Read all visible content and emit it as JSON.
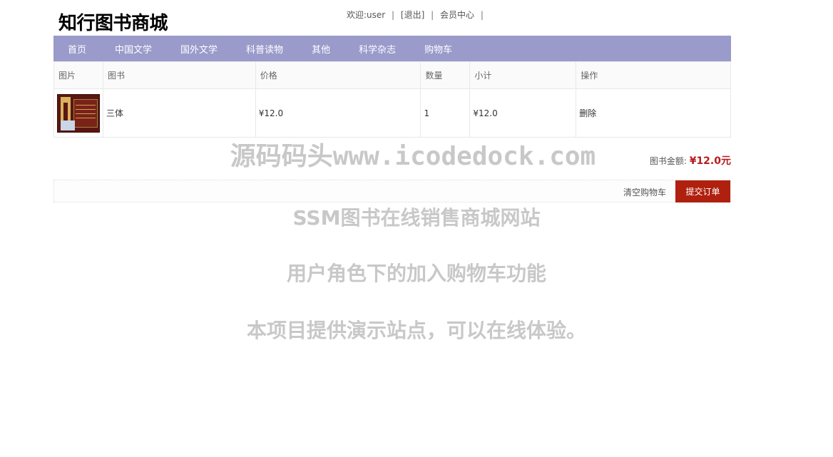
{
  "header": {
    "logo": "知行图书商城",
    "welcome": "欢迎:user",
    "logout": "[退出]",
    "member_center": "会员中心",
    "separator": "|"
  },
  "nav": {
    "items": [
      "首页",
      "中国文学",
      "国外文学",
      "科普读物",
      "其他",
      "科学杂志",
      "购物车"
    ]
  },
  "cart_table": {
    "columns": [
      "图片",
      "图书",
      "价格",
      "数量",
      "小计",
      "操作"
    ],
    "rows": [
      {
        "image": "book-cover",
        "title": "三体",
        "price": "¥12.0",
        "quantity": "1",
        "subtotal": "¥12.0",
        "action": "删除"
      }
    ]
  },
  "summary": {
    "label": "图书金额:",
    "amount": "¥12.0元"
  },
  "actions": {
    "clear": "清空购物车",
    "submit": "提交订单"
  },
  "watermark": {
    "line1": "源码码头www.icodedock.com",
    "line2": "SSM图书在线销售商城网站",
    "line3": "用户角色下的加入购物车功能",
    "line4": "本项目提供演示站点，可以在线体验。"
  },
  "colors": {
    "nav_bg": "#9a9acb",
    "submit_bg": "#b0200f",
    "amount": "#b81c1c"
  }
}
